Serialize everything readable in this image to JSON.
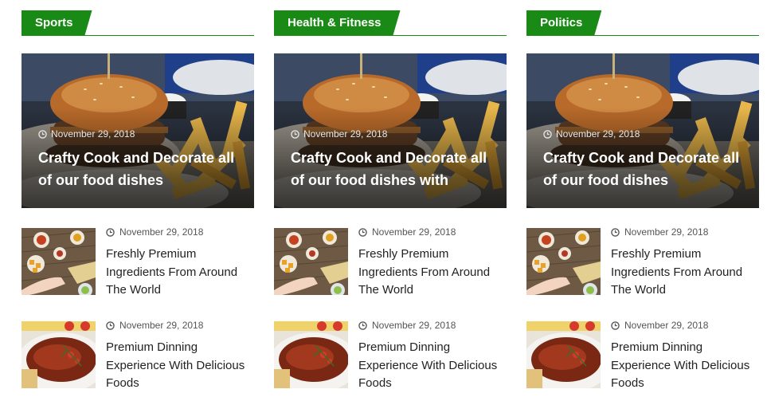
{
  "columns": [
    {
      "category": "Sports",
      "feature": {
        "date": "November 29, 2018",
        "title": "Crafty Cook and Decorate all of our food dishes"
      },
      "items": [
        {
          "date": "November 29, 2018",
          "title": "Freshly Premium Ingredients From Around The World"
        },
        {
          "date": "November 29, 2018",
          "title": "Premium Dinning Experience With Delicious Foods"
        }
      ]
    },
    {
      "category": "Health & Fitness",
      "feature": {
        "date": "November 29, 2018",
        "title": "Crafty Cook and Decorate all of our food dishes with"
      },
      "items": [
        {
          "date": "November 29, 2018",
          "title": "Freshly Premium Ingredients From Around The World"
        },
        {
          "date": "November 29, 2018",
          "title": "Premium Dinning Experience With Delicious Foods"
        }
      ]
    },
    {
      "category": "Politics",
      "feature": {
        "date": "November 29, 2018",
        "title": "Crafty Cook and Decorate all of our food dishes"
      },
      "items": [
        {
          "date": "November 29, 2018",
          "title": "Freshly Premium Ingredients From Around The World"
        },
        {
          "date": "November 29, 2018",
          "title": "Premium Dinning Experience With Delicious Foods"
        }
      ]
    }
  ],
  "icons": {
    "date": "clock-icon"
  },
  "colors": {
    "accent": "#1a8a16",
    "text": "#222222",
    "meta": "#555555"
  }
}
